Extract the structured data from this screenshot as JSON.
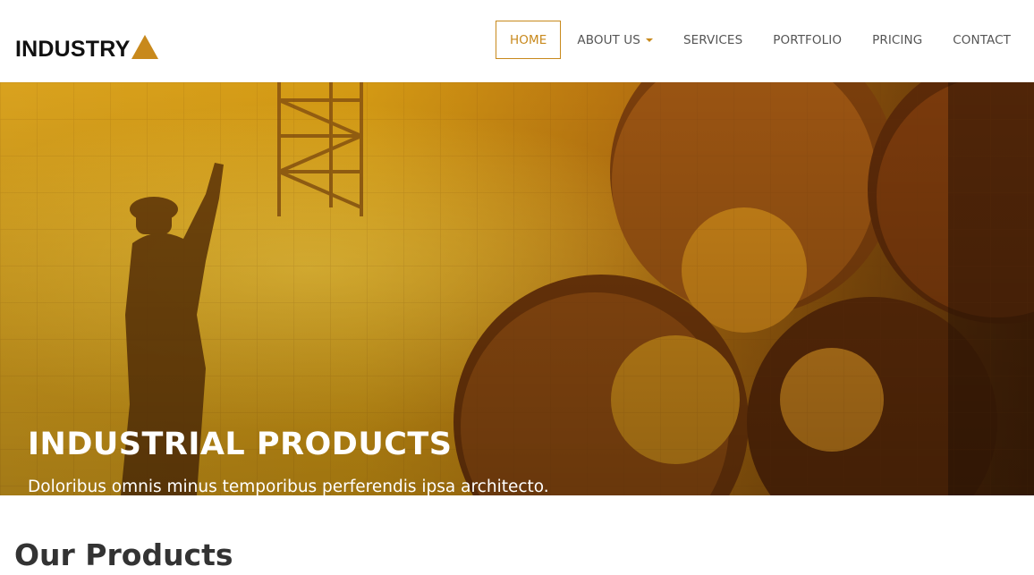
{
  "brand": {
    "name": "INDUSTRY",
    "accent_color": "#c8891c",
    "logo_icon": "triangle-icon"
  },
  "nav": {
    "items": [
      {
        "label": "HOME",
        "active": true
      },
      {
        "label": "ABOUT US",
        "has_dropdown": true
      },
      {
        "label": "SERVICES"
      },
      {
        "label": "PORTFOLIO"
      },
      {
        "label": "PRICING"
      },
      {
        "label": "CONTACT"
      }
    ]
  },
  "hero": {
    "title": "INDUSTRIAL PRODUCTS",
    "subtitle": "Doloribus omnis minus temporibus perferendis ipsa architecto.",
    "image": "worker-and-steel-pipes-photo"
  },
  "products": {
    "heading": "Our Products"
  }
}
